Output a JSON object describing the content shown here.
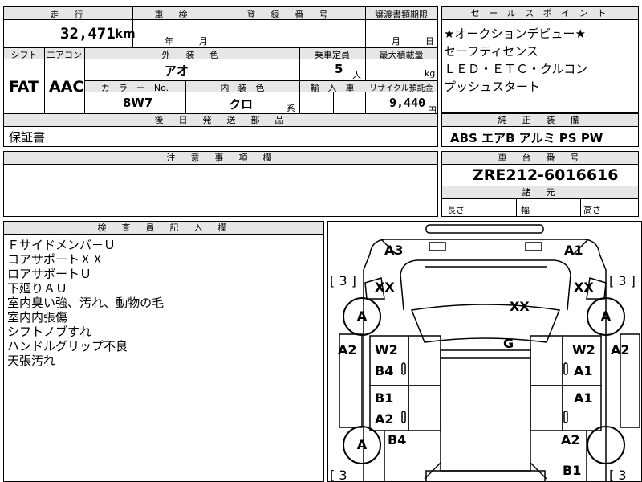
{
  "top": {
    "mileage_header": "走　行",
    "mileage_value": "32,471",
    "mileage_unit": "km",
    "inspection_header": "車　検",
    "inspection_year": "年",
    "inspection_month": "月",
    "registration_header": "登　録　番　号",
    "transfer_header": "譲渡書類期限",
    "transfer_month": "月",
    "transfer_day": "日",
    "shift_header": "シフト",
    "ac_header": "エアコン",
    "shift_value": "FAT",
    "ac_value": "AAC",
    "exterior_header": "外　装　色",
    "exterior_value": "アオ",
    "capacity_header": "乗車定員",
    "capacity_value": "5",
    "capacity_unit": "人",
    "load_header": "最大積載量",
    "load_unit": "kg",
    "color_no_header": "カ　ラ　ー　No.",
    "color_no_value": "8W7",
    "interior_header": "内　装　色",
    "interior_value": "クロ",
    "interior_unit": "系",
    "import_header": "輸　入　車",
    "recycle_header": "リサイクル預託金",
    "recycle_value": "9,440",
    "recycle_unit": "円",
    "parts_header": "後　日　発　送　部　品",
    "parts_value": "保証書"
  },
  "sales": {
    "header": "セ ー ル ス ポ イ ン ト",
    "lines": [
      "★オークションデビュー★",
      "セーフティセンス",
      "ＬＥＤ・ＥＴＣ・クルコン",
      "プッシュスタート"
    ]
  },
  "equipment": {
    "header": "純　正　装　備",
    "value": "ABS エアB アルミ PS PW"
  },
  "notes": {
    "header": "注　意　事　項　欄"
  },
  "chassis": {
    "header": "車　台　番　号",
    "value": "ZRE212-6016616",
    "dims_header": "諸　元",
    "length": "長さ",
    "width": "幅",
    "height": "高さ"
  },
  "inspector": {
    "header": "検　査　員　記　入　欄",
    "lines": [
      "Ｆサイドメンバ－Ｕ",
      "コアサポートＸＸ",
      "ロアサポートＵ",
      "下廻りＡＵ",
      "室内臭い強、汚れ、動物の毛",
      "室内内張傷",
      "シフトノブすれ",
      "ハンドルグリップ不良",
      "天張汚れ"
    ]
  },
  "diagram": {
    "a3": "A3",
    "a1_top": "A1",
    "bracket_left": "[ 3 ]",
    "bracket_right": "[ 3 ]",
    "xx_left": "XX",
    "xx_right": "XX",
    "xx_hood": "XX",
    "tire_fl": "A",
    "tire_fr": "A",
    "tire_rl": "A",
    "a2_left": "A2",
    "a2_right": "A2",
    "w2_left": "W2",
    "b4_left": "B4",
    "g": "G",
    "w2_right": "W2",
    "a1_right": "A1",
    "b1_left": "B1",
    "a2_ld": "A2",
    "a1_rd": "A1",
    "b4_rear": "B4",
    "a2_rear": "A2",
    "b1_rear": "B1",
    "bracket_bl": "[ 3",
    "bracket_br": "[ 3"
  }
}
